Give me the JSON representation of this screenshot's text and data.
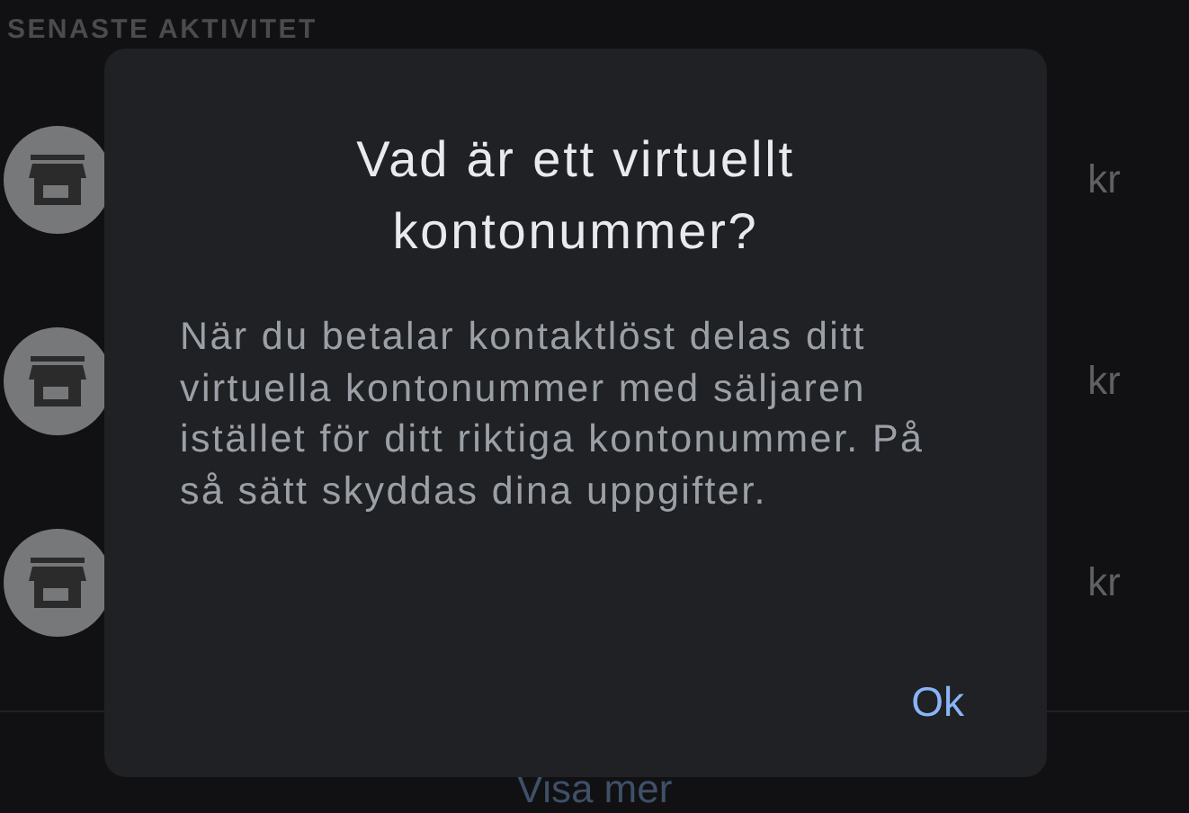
{
  "activity": {
    "heading": "SENASTE AKTIVITET",
    "rows": [
      {
        "amount": "kr"
      },
      {
        "amount": "kr"
      },
      {
        "amount": "kr"
      }
    ],
    "show_more": "Visa mer"
  },
  "dialog": {
    "title": "Vad är ett virtuellt kontonummer?",
    "body": "När du betalar kontaktlöst delas ditt virtuella kontonummer med säljaren istället för ditt riktiga kontonummer. På så sätt skyddas dina uppgifter.",
    "button": "Ok"
  }
}
